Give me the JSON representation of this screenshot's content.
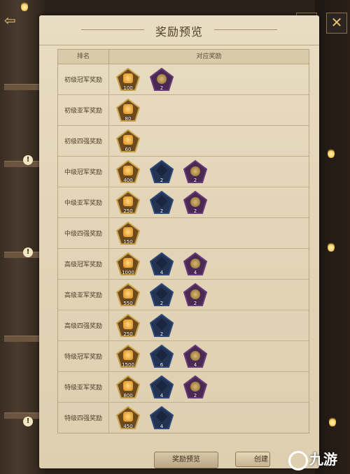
{
  "header": {
    "title": "奖励预览",
    "close_symbol": "✕"
  },
  "table": {
    "col_rank": "排名",
    "col_reward": "对应奖励",
    "rows": [
      {
        "rank": "初级冠军奖励",
        "rewards": [
          {
            "type": "gold",
            "qty": "100"
          },
          {
            "type": "purple",
            "qty": "2"
          }
        ]
      },
      {
        "rank": "初级亚军奖励",
        "rewards": [
          {
            "type": "gold",
            "qty": "80"
          }
        ]
      },
      {
        "rank": "初级四强奖励",
        "rewards": [
          {
            "type": "gold",
            "qty": "60"
          }
        ]
      },
      {
        "rank": "中级冠军奖励",
        "rewards": [
          {
            "type": "gold",
            "qty": "400"
          },
          {
            "type": "blue",
            "qty": "2"
          },
          {
            "type": "purple",
            "qty": "2"
          }
        ]
      },
      {
        "rank": "中级亚军奖励",
        "rewards": [
          {
            "type": "gold",
            "qty": "250"
          },
          {
            "type": "blue",
            "qty": "2"
          },
          {
            "type": "purple",
            "qty": "2"
          }
        ]
      },
      {
        "rank": "中级四强奖励",
        "rewards": [
          {
            "type": "gold",
            "qty": "150"
          }
        ]
      },
      {
        "rank": "高级冠军奖励",
        "rewards": [
          {
            "type": "gold",
            "qty": "1000"
          },
          {
            "type": "blue",
            "qty": "4"
          },
          {
            "type": "purple",
            "qty": "4"
          }
        ]
      },
      {
        "rank": "高级亚军奖励",
        "rewards": [
          {
            "type": "gold",
            "qty": "550"
          },
          {
            "type": "blue",
            "qty": "2"
          },
          {
            "type": "purple",
            "qty": "2"
          }
        ]
      },
      {
        "rank": "高级四强奖励",
        "rewards": [
          {
            "type": "gold",
            "qty": "250"
          },
          {
            "type": "blue",
            "qty": "2"
          }
        ]
      },
      {
        "rank": "特级冠军奖励",
        "rewards": [
          {
            "type": "gold",
            "qty": "1500"
          },
          {
            "type": "blue",
            "qty": "6"
          },
          {
            "type": "purple",
            "qty": "4"
          }
        ]
      },
      {
        "rank": "特级亚军奖励",
        "rewards": [
          {
            "type": "gold",
            "qty": "800"
          },
          {
            "type": "blue",
            "qty": "4"
          },
          {
            "type": "purple",
            "qty": "2"
          }
        ]
      },
      {
        "rank": "特级四强奖励",
        "rewards": [
          {
            "type": "gold",
            "qty": "450"
          },
          {
            "type": "blue",
            "qty": "4"
          }
        ]
      }
    ]
  },
  "buttons": {
    "preview_label": "奖励预览",
    "create_label": "创建"
  },
  "side_alert_symbol": "!",
  "back_symbol": "⇦",
  "watermark": {
    "text": "九游"
  },
  "colors": {
    "gold_frame": "#c9a14a",
    "blue_frame": "#2f4a7a",
    "purple_frame": "#6a3a7a",
    "accent": "#e8c36a"
  }
}
